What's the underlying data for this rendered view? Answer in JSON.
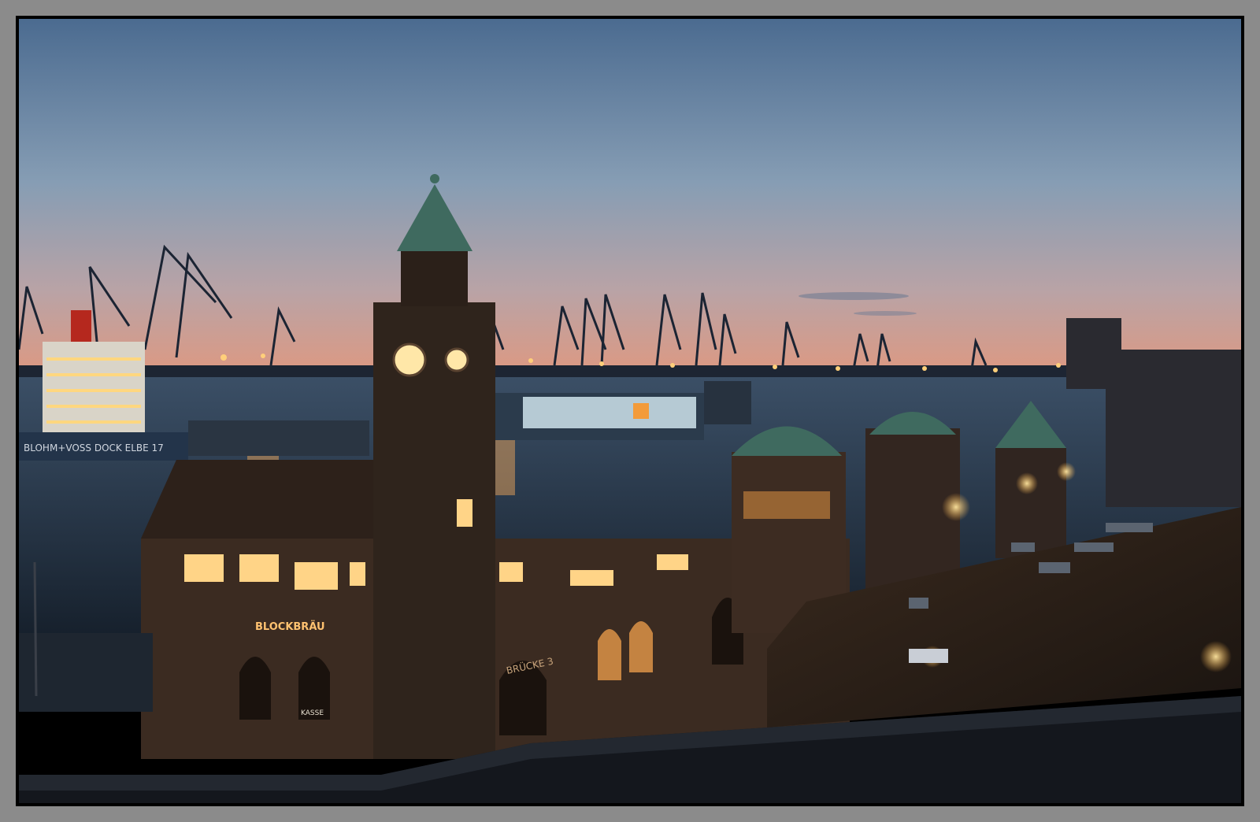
{
  "photo": {
    "subject": "Harbor at dusk with clock tower, river, cranes and cruise ship",
    "signs": {
      "dock": "BLOHM+VOSS DOCK ELBE 17",
      "restaurant": "BLOCKBRÄU",
      "ticket": "KASSE",
      "bridge": "BRÜCKE 3"
    },
    "colors": {
      "sky_top": "#4c6d92",
      "sky_mid": "#8aa0b6",
      "sky_horizon": "#d99a86",
      "water": "#1c2c3e",
      "lights": "#ffd27a",
      "stone": "#3a2c22",
      "dome": "#3f6a5f"
    }
  }
}
